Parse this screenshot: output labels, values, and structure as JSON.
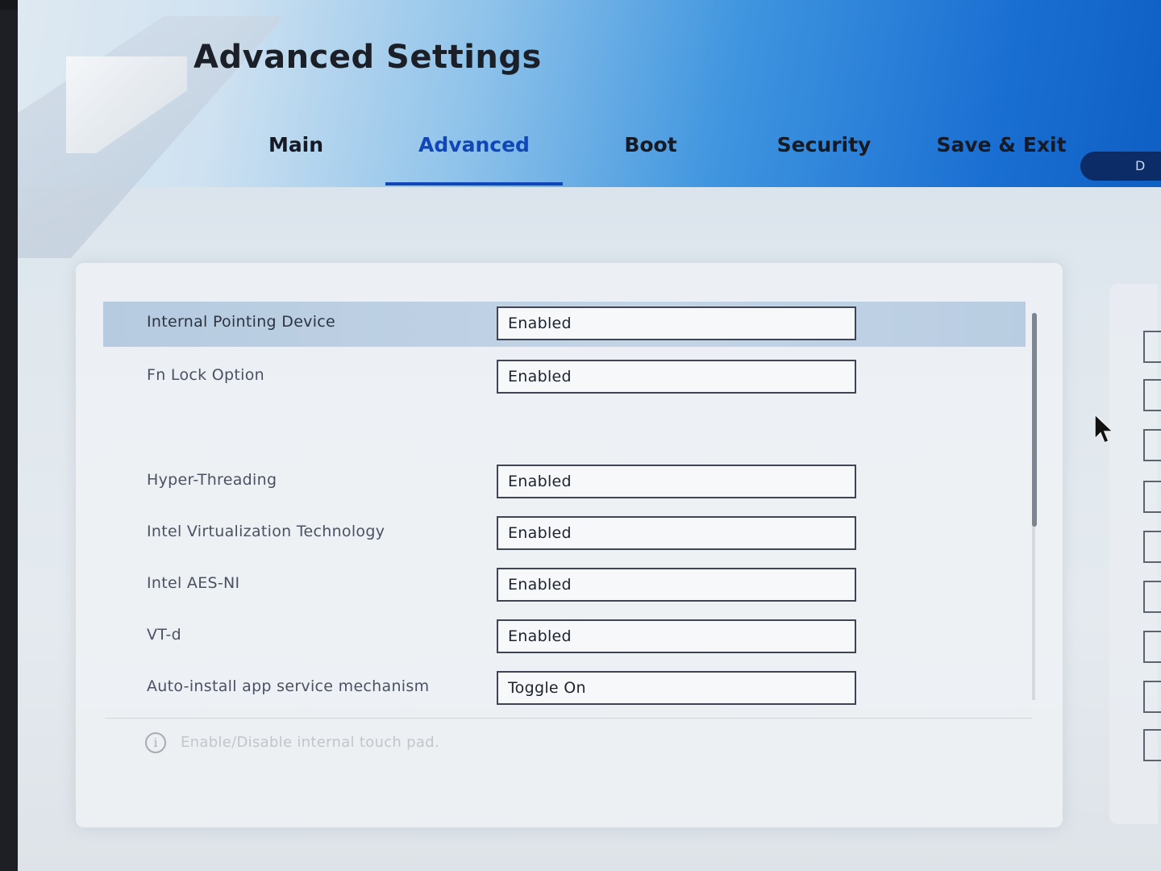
{
  "header": {
    "title": "Advanced Settings"
  },
  "tabs": [
    {
      "label": "Main",
      "active": false
    },
    {
      "label": "Advanced",
      "active": true
    },
    {
      "label": "Boot",
      "active": false
    },
    {
      "label": "Security",
      "active": false
    },
    {
      "label": "Save & Exit",
      "active": false
    }
  ],
  "tab_pill_label": "D",
  "settings": [
    {
      "label": "Internal Pointing Device",
      "value": "Enabled",
      "selected": true
    },
    {
      "label": "Fn Lock Option",
      "value": "Enabled",
      "selected": false
    },
    {
      "label": "Hyper-Threading",
      "value": "Enabled",
      "selected": false
    },
    {
      "label": "Intel Virtualization Technology",
      "value": "Enabled",
      "selected": false
    },
    {
      "label": "Intel AES-NI",
      "value": "Enabled",
      "selected": false
    },
    {
      "label": "VT-d",
      "value": "Enabled",
      "selected": false
    },
    {
      "label": "Auto-install app service mechanism",
      "value": "Toggle On",
      "selected": false
    }
  ],
  "help": {
    "icon": "info-icon",
    "icon_glyph": "i",
    "text": "Enable/Disable internal touch pad."
  },
  "colors": {
    "accent": "#1146b8",
    "selected_row": "#c3d4e6"
  }
}
